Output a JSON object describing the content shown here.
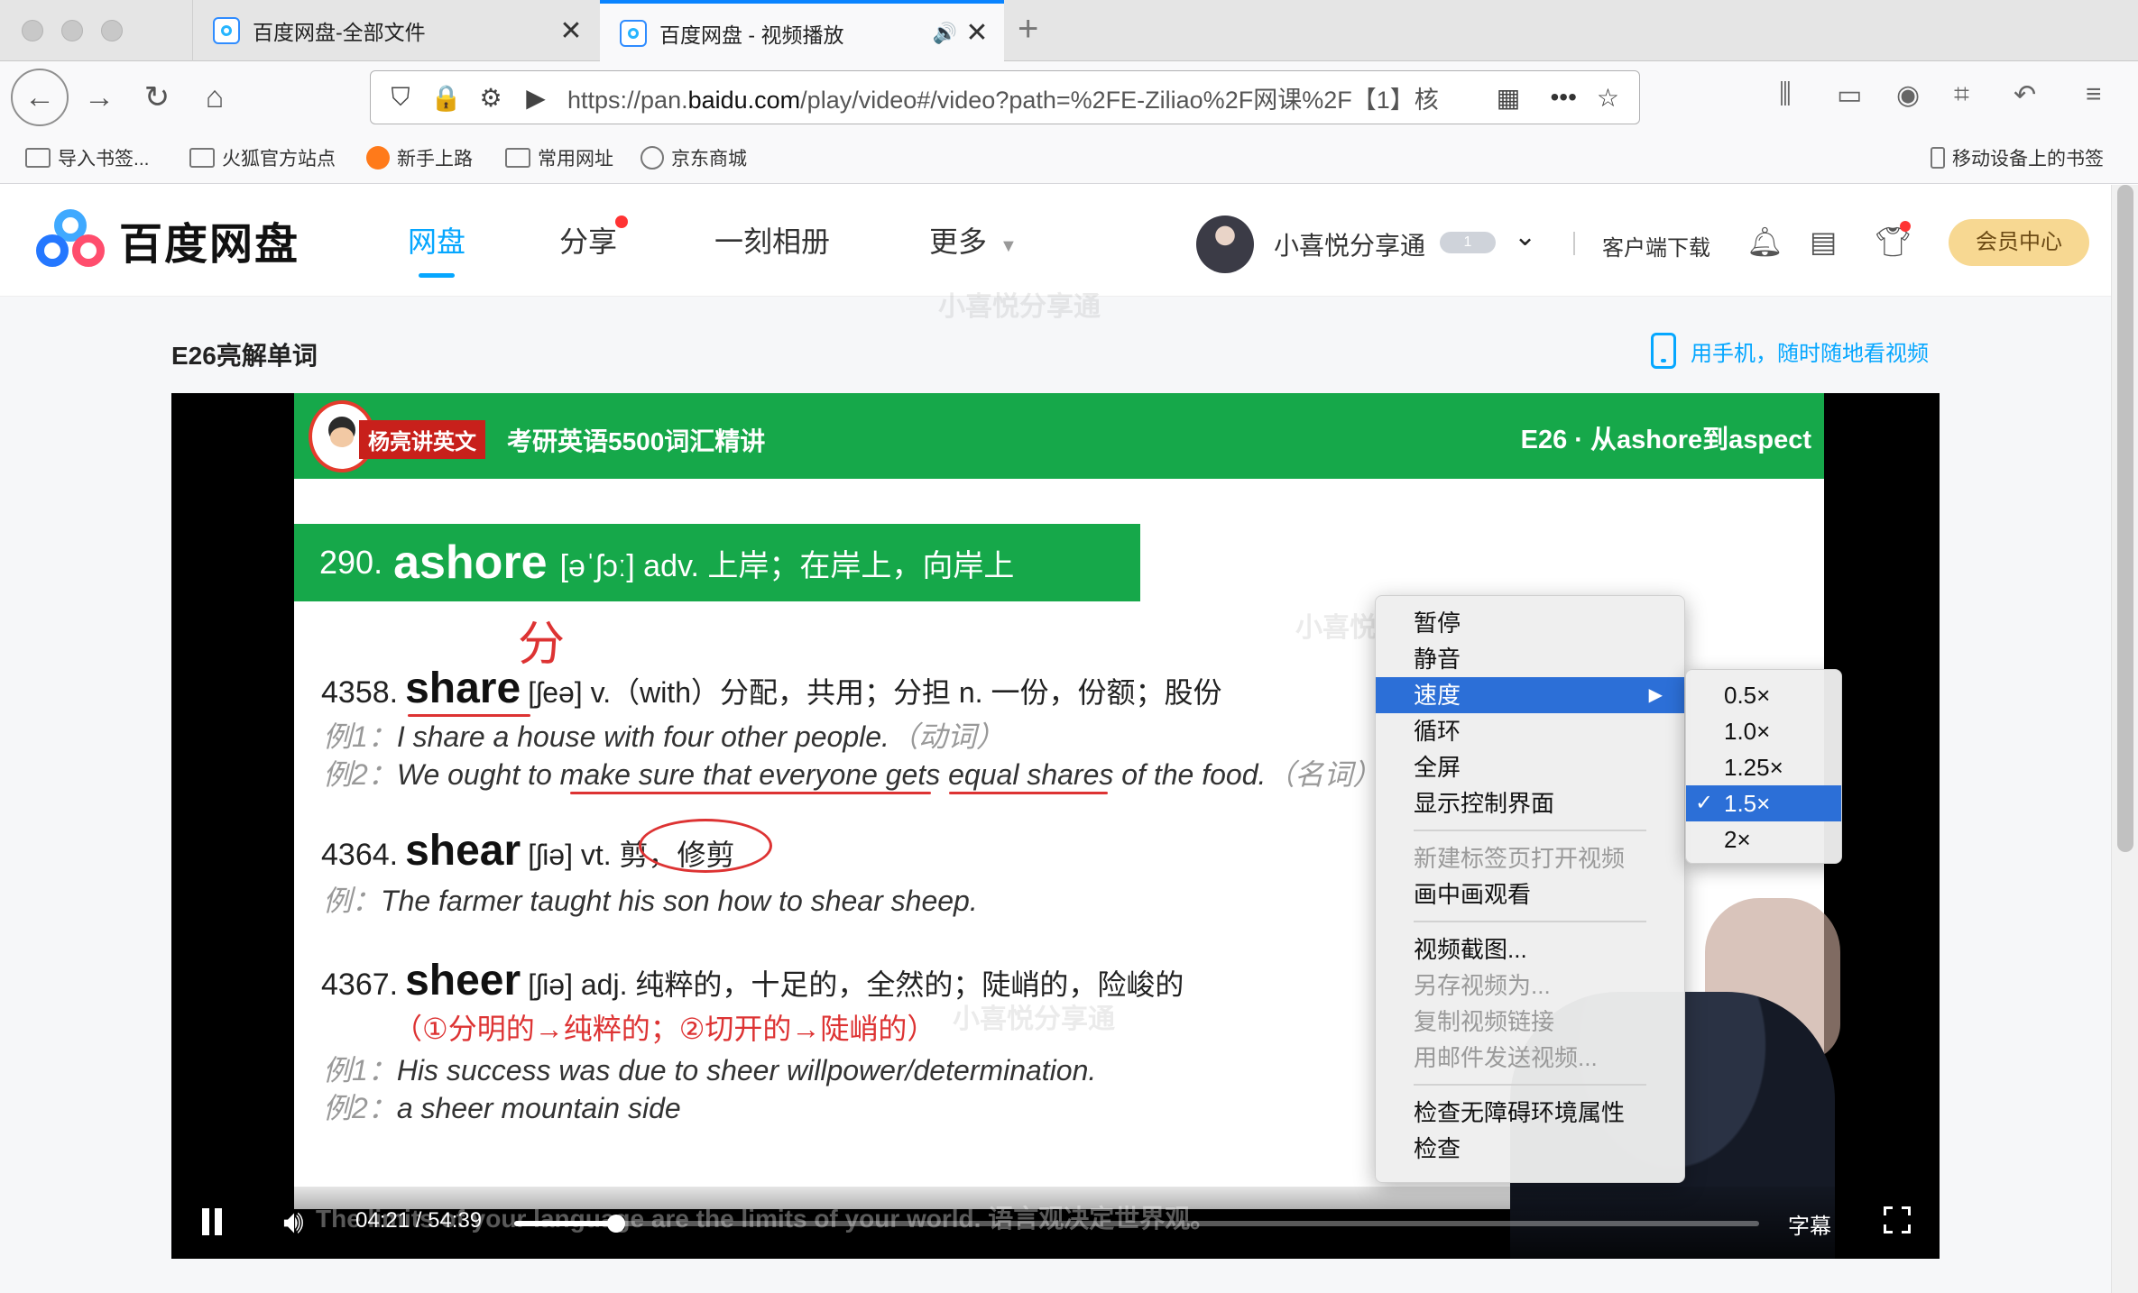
{
  "browser": {
    "tabs": [
      {
        "title": "百度网盘-全部文件",
        "close": "✕"
      },
      {
        "title": "百度网盘 - 视频播放",
        "close": "✕",
        "speaker": "🔊"
      }
    ],
    "new_tab": "+",
    "url_prefix": "https://pan.",
    "url_domain": "baidu.com",
    "url_rest": "/play/video#/video?path=%2FE-Ziliao%2F网课%2F【1】核",
    "url_more": "•••",
    "bookmarks": [
      {
        "label": "导入书签..."
      },
      {
        "label": "火狐官方站点"
      },
      {
        "label": "新手上路"
      },
      {
        "label": "常用网址"
      },
      {
        "label": "京东商城"
      }
    ],
    "mobile_bookmarks": "移动设备上的书签"
  },
  "site": {
    "logo_text": "百度网盘",
    "nav": [
      {
        "label": "网盘"
      },
      {
        "label": "分享"
      },
      {
        "label": "一刻相册"
      },
      {
        "label": "更多"
      }
    ],
    "username": "小喜悦分享通",
    "vip_level": "1",
    "client_download": "客户端下载",
    "vip_center": "会员中心"
  },
  "video": {
    "title": "E26亮解单词",
    "mobile_link": "用手机，随时随地看视频",
    "current_time": "04:21",
    "time_sep": "/",
    "duration": "54:39",
    "progress_fraction": 0.082,
    "subtitle_btn": "字幕",
    "subtitle_overlay": "The limits of your language are the limits of your world. 语言观决定世界观。"
  },
  "slide": {
    "teacher_tag": "杨亮讲英文",
    "course": "考研英语5500词汇精讲",
    "episode": "E26 · 从ashore到aspect",
    "banner_num": "290.",
    "banner_word": "ashore",
    "banner_rest": "[əˈʃɔː] adv. 上岸；在岸上，向岸上",
    "note_fen": "分",
    "entries": [
      {
        "num": "4358.",
        "word": "share",
        "def": "[ʃeə] v.（with）分配，共用；分担 n. 一份，份额；股份"
      },
      {
        "num": "4364.",
        "word": "shear",
        "def": "[ʃiə] vt. 剪，修剪"
      },
      {
        "num": "4367.",
        "word": "sheer",
        "def": "[ʃiə] adj. 纯粹的，十足的，全然的；陡峭的，险峻的"
      }
    ],
    "examples": [
      {
        "label": "例1：",
        "text": "I share a house with four other people.",
        "note": "（动词）"
      },
      {
        "label": "例2：",
        "text": "We ought to make sure that everyone gets equal shares of the food.",
        "note": "（名词）"
      },
      {
        "label": "例：",
        "text": "The farmer taught his son how to shear sheep.",
        "note": ""
      },
      {
        "label": "例1：",
        "text": "His success was due to sheer willpower/determination.",
        "note": ""
      },
      {
        "label": "例2：",
        "text": "a sheer mountain side",
        "note": ""
      }
    ],
    "etymology": "（①分明的→纯粹的；②切开的→陡峭的）"
  },
  "context_menu": {
    "items": [
      {
        "label": "暂停",
        "state": "normal"
      },
      {
        "label": "静音",
        "state": "normal"
      },
      {
        "label": "速度",
        "state": "highlight",
        "submenu": true
      },
      {
        "label": "循环",
        "state": "normal"
      },
      {
        "label": "全屏",
        "state": "normal"
      },
      {
        "label": "显示控制界面",
        "state": "normal"
      },
      {
        "sep": true
      },
      {
        "label": "新建标签页打开视频",
        "state": "disabled"
      },
      {
        "label": "画中画观看",
        "state": "normal"
      },
      {
        "sep": true
      },
      {
        "label": "视频截图...",
        "state": "normal"
      },
      {
        "label": "另存视频为...",
        "state": "disabled"
      },
      {
        "label": "复制视频链接",
        "state": "disabled"
      },
      {
        "label": "用邮件发送视频...",
        "state": "disabled"
      },
      {
        "sep": true
      },
      {
        "label": "检查无障碍环境属性",
        "state": "normal"
      },
      {
        "label": "检查",
        "state": "normal"
      }
    ],
    "speed_options": [
      {
        "label": "0.5×",
        "selected": false
      },
      {
        "label": "1.0×",
        "selected": false
      },
      {
        "label": "1.25×",
        "selected": false
      },
      {
        "label": "1.5×",
        "selected": true
      },
      {
        "label": "2×",
        "selected": false
      }
    ],
    "submenu_arrow": "▶",
    "check": "✓"
  },
  "watermark": "小喜悦分享通",
  "colors": {
    "accent": "#06a7ff",
    "slide_green": "#16a84a",
    "menu_highlight": "#2c6fd7",
    "vip": "#f7d892"
  }
}
